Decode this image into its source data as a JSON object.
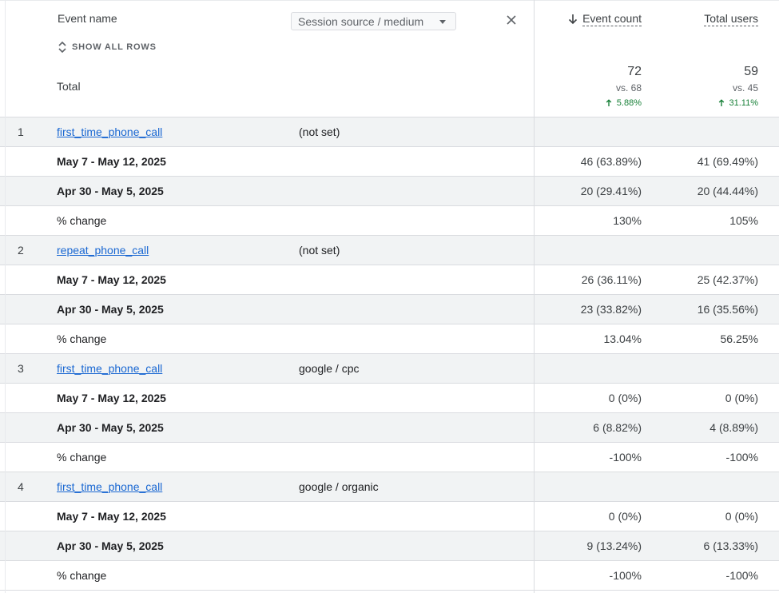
{
  "header": {
    "event_name": "Event name",
    "show_all_rows": "SHOW ALL ROWS",
    "total": "Total",
    "dimension_select": "Session source / medium",
    "metrics": [
      {
        "label": "Event count",
        "sorted": "descending"
      },
      {
        "label": "Total users"
      }
    ]
  },
  "totals": {
    "event_count": {
      "value": "72",
      "vs": "vs. 68",
      "change": "5.88%"
    },
    "total_users": {
      "value": "59",
      "vs": "vs. 45",
      "change": "31.11%"
    }
  },
  "colors": {
    "link": "#1967d2",
    "positive": "#188038",
    "row_alt": "#f1f3f4",
    "border": "#dadce0"
  },
  "groups": [
    {
      "index": "1",
      "event": "first_time_phone_call",
      "source": "(not set)",
      "rows": [
        {
          "label": "May 7 - May 12, 2025",
          "count": "46 (63.89%)",
          "users": "41 (69.49%)"
        },
        {
          "label": "Apr 30 - May 5, 2025",
          "count": "20 (29.41%)",
          "users": "20 (44.44%)"
        },
        {
          "label": "% change",
          "count": "130%",
          "users": "105%"
        }
      ]
    },
    {
      "index": "2",
      "event": "repeat_phone_call",
      "source": "(not set)",
      "rows": [
        {
          "label": "May 7 - May 12, 2025",
          "count": "26 (36.11%)",
          "users": "25 (42.37%)"
        },
        {
          "label": "Apr 30 - May 5, 2025",
          "count": "23 (33.82%)",
          "users": "16 (35.56%)"
        },
        {
          "label": "% change",
          "count": "13.04%",
          "users": "56.25%"
        }
      ]
    },
    {
      "index": "3",
      "event": "first_time_phone_call",
      "source": "google / cpc",
      "rows": [
        {
          "label": "May 7 - May 12, 2025",
          "count": "0 (0%)",
          "users": "0 (0%)"
        },
        {
          "label": "Apr 30 - May 5, 2025",
          "count": "6 (8.82%)",
          "users": "4 (8.89%)"
        },
        {
          "label": "% change",
          "count": "-100%",
          "users": "-100%"
        }
      ]
    },
    {
      "index": "4",
      "event": "first_time_phone_call",
      "source": "google / organic",
      "rows": [
        {
          "label": "May 7 - May 12, 2025",
          "count": "0 (0%)",
          "users": "0 (0%)"
        },
        {
          "label": "Apr 30 - May 5, 2025",
          "count": "9 (13.24%)",
          "users": "6 (13.33%)"
        },
        {
          "label": "% change",
          "count": "-100%",
          "users": "-100%"
        }
      ]
    }
  ]
}
